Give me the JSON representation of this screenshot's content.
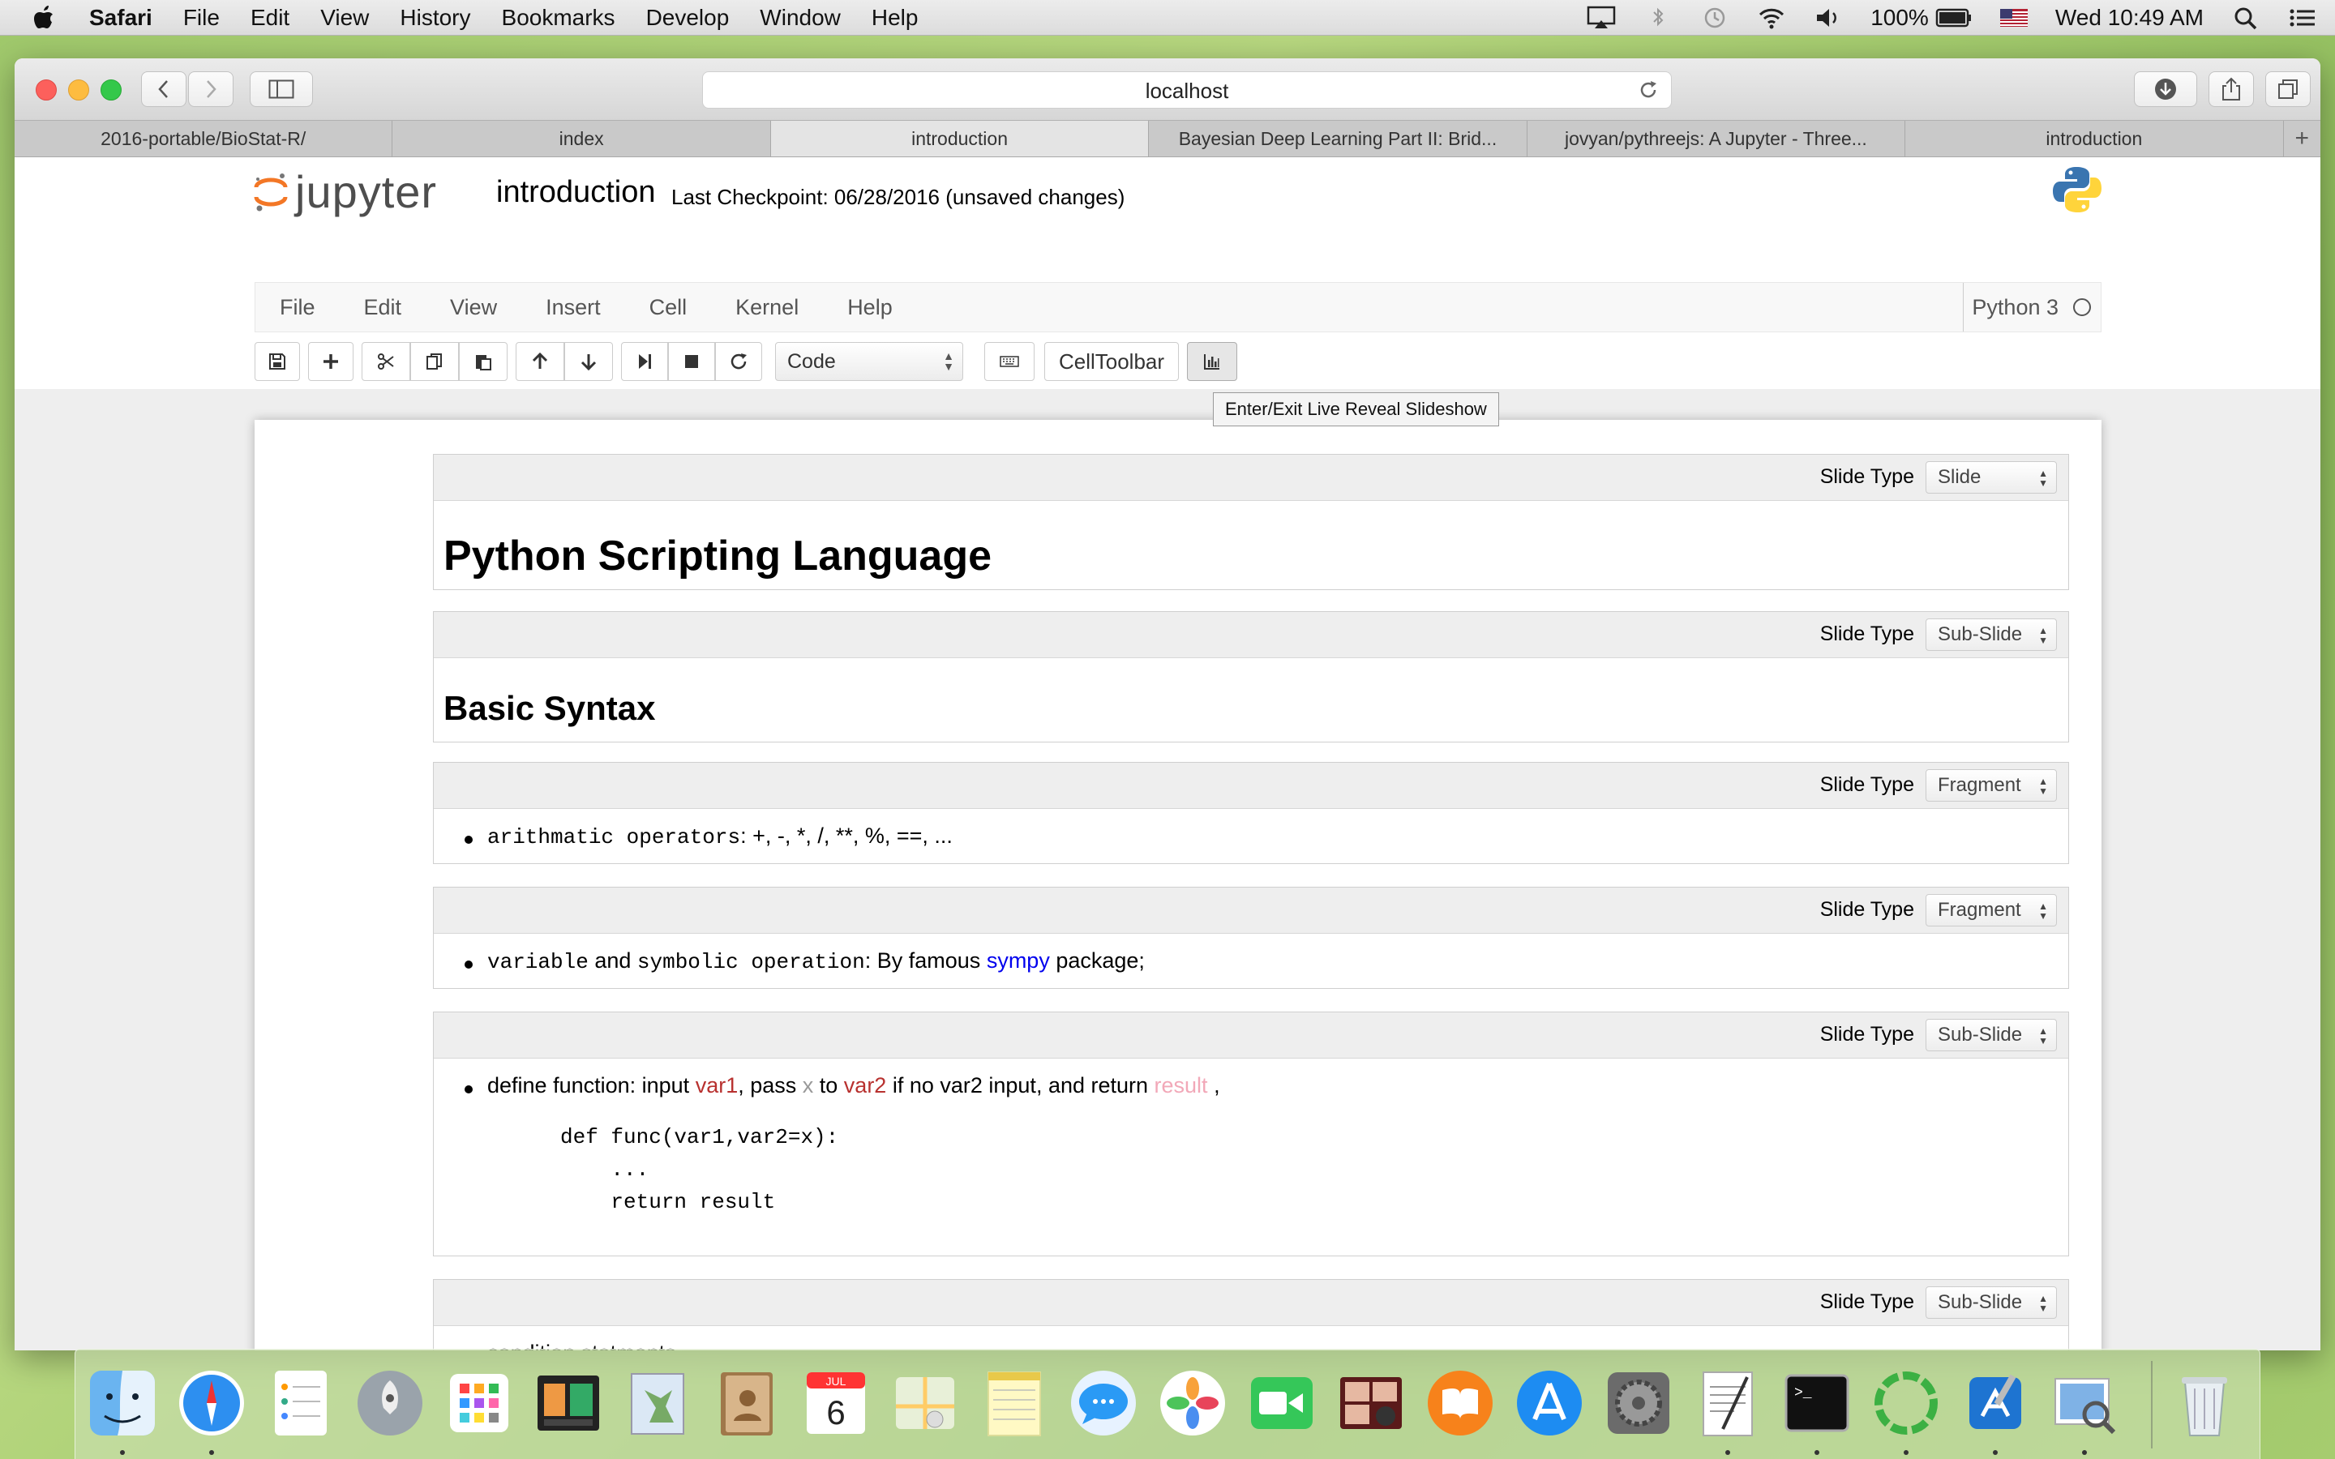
{
  "menubar": {
    "items": [
      "Safari",
      "File",
      "Edit",
      "View",
      "History",
      "Bookmarks",
      "Develop",
      "Window",
      "Help"
    ],
    "battery": "100%",
    "datetime": "Wed 10:49 AM"
  },
  "browser": {
    "url": "localhost",
    "tabs": [
      {
        "label": "2016-portable/BioStat-R/",
        "active": false
      },
      {
        "label": "index",
        "active": false
      },
      {
        "label": "introduction",
        "active": true
      },
      {
        "label": "Bayesian Deep Learning Part II: Brid...",
        "active": false
      },
      {
        "label": "jovyan/pythreejs: A Jupyter - Three...",
        "active": false
      },
      {
        "label": "introduction",
        "active": false
      }
    ],
    "add_tab": "+"
  },
  "jupyter": {
    "logo_text": "jupyter",
    "notebook_name": "introduction",
    "checkpoint": "Last Checkpoint: 06/28/2016 (unsaved changes)",
    "menus": [
      "File",
      "Edit",
      "View",
      "Insert",
      "Cell",
      "Kernel",
      "Help"
    ],
    "kernel_name": "Python 3",
    "cell_type": "Code",
    "celltoolbar_label": "CellToolbar",
    "tooltip": "Enter/Exit Live Reveal Slideshow"
  },
  "cells": {
    "slide_type_label": "Slide Type",
    "c1": {
      "slide_type": "Slide",
      "heading": "Python Scripting Language"
    },
    "c2": {
      "slide_type": "Sub-Slide",
      "heading": "Basic Syntax"
    },
    "c3": {
      "slide_type": "Fragment",
      "code": "arithmatic operators",
      "text": ": +, -, *, /, **, %, ==, ..."
    },
    "c4": {
      "slide_type": "Fragment",
      "code1": "variable",
      "text1": " and ",
      "code2": "symbolic operation",
      "text2": ": By famous ",
      "link": "sympy",
      "text3": " package;"
    },
    "c5": {
      "slide_type": "Sub-Slide",
      "t1": "define function: input ",
      "var1": "var1",
      "t2": ", pass ",
      "x": "x",
      "t3": " to ",
      "var2": "var2",
      "t4": " if no var2 input, and return ",
      "result": "result",
      "t5": " ,",
      "code_lines": [
        "def func(var1,var2=x):",
        "    ...",
        "    return result"
      ]
    },
    "c6": {
      "slide_type": "Sub-Slide",
      "item": "condition statments"
    }
  },
  "dock": {
    "apps": [
      "finder-icon",
      "safari-icon",
      "reminders-icon",
      "launchpad-icon",
      "dashboard-icon",
      "photo-booth-icon",
      "preview-bird-icon",
      "contacts-icon",
      "calendar-icon",
      "maps-icon",
      "notes-icon",
      "messages-icon",
      "photos-icon",
      "facetime-icon",
      "photo-booth-icon",
      "ibooks-icon",
      "app-store-icon",
      "system-preferences-icon",
      "textedit-icon",
      "terminal-icon",
      "sync-icon",
      "xcode-icon",
      "preview-icon",
      "trash-icon"
    ],
    "calendar_month": "JUL",
    "calendar_day": "6",
    "terminal_prompt": ">_"
  }
}
